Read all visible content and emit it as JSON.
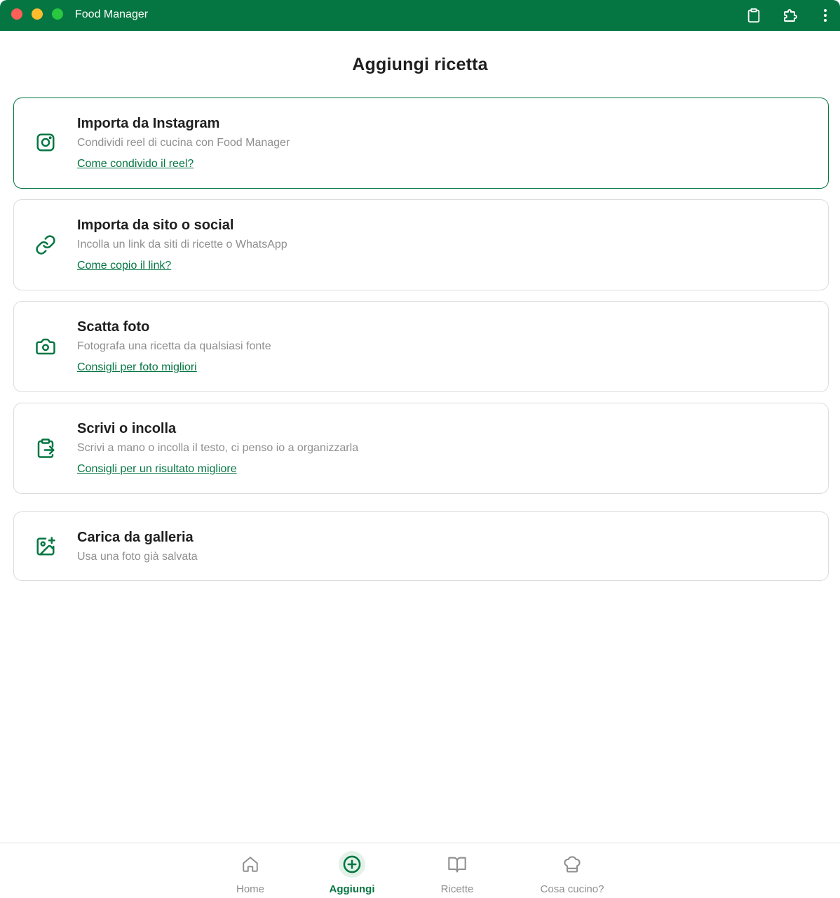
{
  "window": {
    "title": "Food Manager",
    "accent_color": "#057642"
  },
  "toolbar": {
    "icons": [
      "clipboard-icon",
      "extension-icon",
      "more-vertical-icon"
    ]
  },
  "page": {
    "title": "Aggiungi ricetta"
  },
  "options": [
    {
      "icon": "instagram-icon",
      "title": "Importa da Instagram",
      "subtitle": "Condividi reel di cucina con Food Manager",
      "link": "Come condivido il reel?"
    },
    {
      "icon": "link-icon",
      "title": "Importa da sito o social",
      "subtitle": "Incolla un link da siti di ricette o WhatsApp",
      "link": "Come copio il link?"
    },
    {
      "icon": "camera-icon",
      "title": "Scatta foto",
      "subtitle": "Fotografa una ricetta da qualsiasi fonte",
      "link": "Consigli per foto migliori"
    },
    {
      "icon": "clipboard-paste-icon",
      "title": "Scrivi o incolla",
      "subtitle": "Scrivi a mano o incolla il testo, ci penso io a organizzarla",
      "link": "Consigli per un risultato migliore"
    },
    {
      "icon": "image-plus-icon",
      "title": "Carica da galleria",
      "subtitle": "Usa una foto già salvata"
    }
  ],
  "bottom_nav": {
    "items": [
      {
        "icon": "home-icon",
        "label": "Home"
      },
      {
        "icon": "plus-circle-icon",
        "label": "Aggiungi",
        "selected": true
      },
      {
        "icon": "book-icon",
        "label": "Ricette"
      },
      {
        "icon": "chef-hat-icon",
        "label": "Cosa cucino?"
      }
    ]
  }
}
